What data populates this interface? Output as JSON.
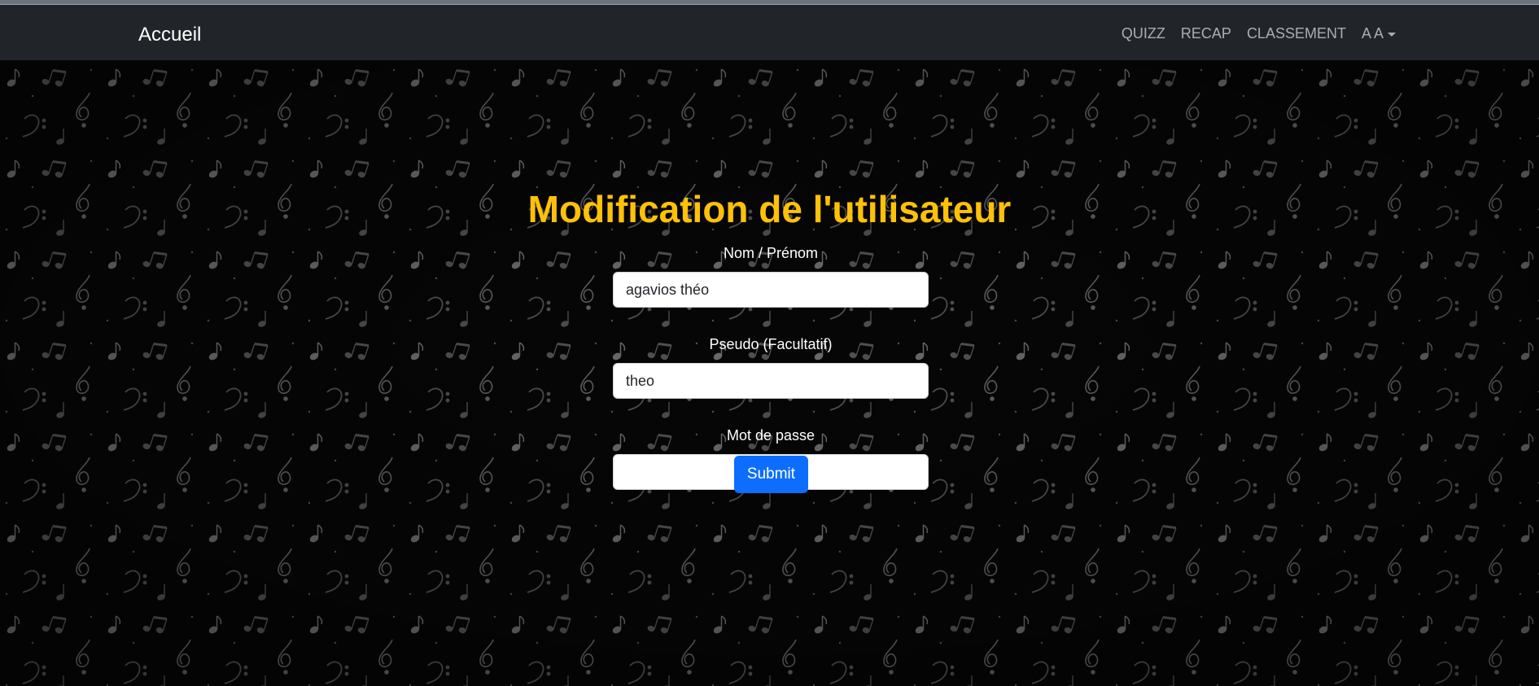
{
  "navbar": {
    "brand": "Accueil",
    "links": [
      "QUIZZ",
      "RECAP",
      "CLASSEMENT"
    ],
    "user_menu": "A A"
  },
  "main": {
    "title": "Modification de l'utilisateur",
    "fields": [
      {
        "label": "Nom / Prénom",
        "value": "agavios théo"
      },
      {
        "label": "Pseudo (Facultatif)",
        "value": "theo"
      },
      {
        "label": "Mot de passe",
        "value": ""
      }
    ],
    "submit_label": "Submit"
  },
  "colors": {
    "navbar_bg": "#212529",
    "title": "#ffc107",
    "button": "#0d6efd",
    "background": "#050505"
  },
  "background_pattern": "music-notes"
}
